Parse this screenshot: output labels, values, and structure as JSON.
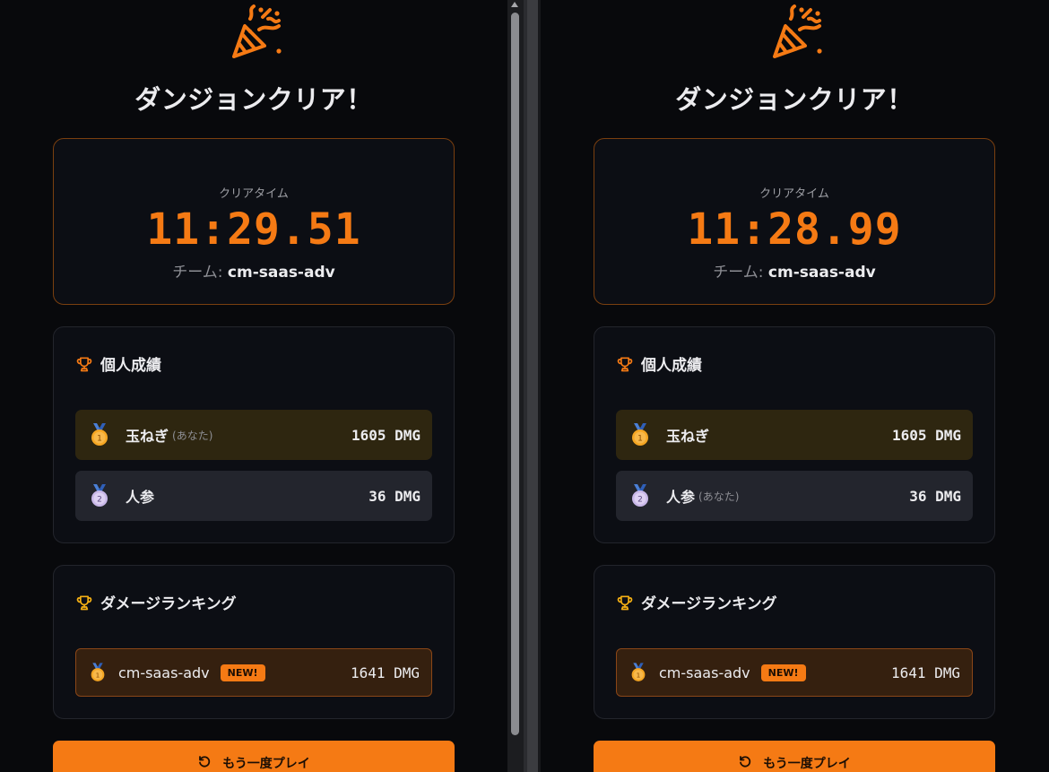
{
  "panes": [
    {
      "title": "ダンジョンクリア！",
      "time_label": "クリアタイム",
      "clear_time": "11:29.51",
      "team_prefix": "チーム: ",
      "team_name": "cm-saas-adv",
      "personal": {
        "heading": "個人成績",
        "rows": [
          {
            "name": "玉ねぎ",
            "you": "(あなた)",
            "dmg": "1605 DMG",
            "medal_rank": "1"
          },
          {
            "name": "人参",
            "you": "",
            "dmg": "36 DMG",
            "medal_rank": "2"
          }
        ]
      },
      "ranking": {
        "heading": "ダメージランキング",
        "rows": [
          {
            "name": "cm-saas-adv",
            "badge": "NEW!",
            "dmg": "1641 DMG"
          }
        ]
      },
      "replay_label": "もう一度プレイ"
    },
    {
      "title": "ダンジョンクリア！",
      "time_label": "クリアタイム",
      "clear_time": "11:28.99",
      "team_prefix": "チーム: ",
      "team_name": "cm-saas-adv",
      "personal": {
        "heading": "個人成績",
        "rows": [
          {
            "name": "玉ねぎ",
            "you": "",
            "dmg": "1605 DMG",
            "medal_rank": "1"
          },
          {
            "name": "人参",
            "you": "(あなた)",
            "dmg": "36 DMG",
            "medal_rank": "2"
          }
        ]
      },
      "ranking": {
        "heading": "ダメージランキング",
        "rows": [
          {
            "name": "cm-saas-adv",
            "badge": "NEW!",
            "dmg": "1641 DMG"
          }
        ]
      },
      "replay_label": "もう一度プレイ"
    }
  ],
  "colors": {
    "accent": "#f57a14",
    "background": "#08090c",
    "card": "#0c0e14",
    "gold_row": "#2e2610",
    "silver_row": "#23252d"
  }
}
